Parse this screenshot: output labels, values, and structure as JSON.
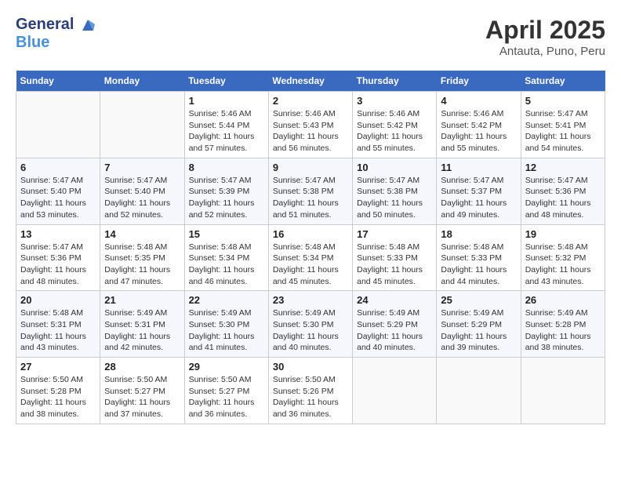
{
  "header": {
    "logo_line1": "General",
    "logo_line2": "Blue",
    "month": "April 2025",
    "location": "Antauta, Puno, Peru"
  },
  "weekdays": [
    "Sunday",
    "Monday",
    "Tuesday",
    "Wednesday",
    "Thursday",
    "Friday",
    "Saturday"
  ],
  "weeks": [
    [
      {
        "day": null
      },
      {
        "day": null
      },
      {
        "day": 1,
        "sunrise": "5:46 AM",
        "sunset": "5:44 PM",
        "daylight": "11 hours and 57 minutes."
      },
      {
        "day": 2,
        "sunrise": "5:46 AM",
        "sunset": "5:43 PM",
        "daylight": "11 hours and 56 minutes."
      },
      {
        "day": 3,
        "sunrise": "5:46 AM",
        "sunset": "5:42 PM",
        "daylight": "11 hours and 55 minutes."
      },
      {
        "day": 4,
        "sunrise": "5:46 AM",
        "sunset": "5:42 PM",
        "daylight": "11 hours and 55 minutes."
      },
      {
        "day": 5,
        "sunrise": "5:47 AM",
        "sunset": "5:41 PM",
        "daylight": "11 hours and 54 minutes."
      }
    ],
    [
      {
        "day": 6,
        "sunrise": "5:47 AM",
        "sunset": "5:40 PM",
        "daylight": "11 hours and 53 minutes."
      },
      {
        "day": 7,
        "sunrise": "5:47 AM",
        "sunset": "5:40 PM",
        "daylight": "11 hours and 52 minutes."
      },
      {
        "day": 8,
        "sunrise": "5:47 AM",
        "sunset": "5:39 PM",
        "daylight": "11 hours and 52 minutes."
      },
      {
        "day": 9,
        "sunrise": "5:47 AM",
        "sunset": "5:38 PM",
        "daylight": "11 hours and 51 minutes."
      },
      {
        "day": 10,
        "sunrise": "5:47 AM",
        "sunset": "5:38 PM",
        "daylight": "11 hours and 50 minutes."
      },
      {
        "day": 11,
        "sunrise": "5:47 AM",
        "sunset": "5:37 PM",
        "daylight": "11 hours and 49 minutes."
      },
      {
        "day": 12,
        "sunrise": "5:47 AM",
        "sunset": "5:36 PM",
        "daylight": "11 hours and 48 minutes."
      }
    ],
    [
      {
        "day": 13,
        "sunrise": "5:47 AM",
        "sunset": "5:36 PM",
        "daylight": "11 hours and 48 minutes."
      },
      {
        "day": 14,
        "sunrise": "5:48 AM",
        "sunset": "5:35 PM",
        "daylight": "11 hours and 47 minutes."
      },
      {
        "day": 15,
        "sunrise": "5:48 AM",
        "sunset": "5:34 PM",
        "daylight": "11 hours and 46 minutes."
      },
      {
        "day": 16,
        "sunrise": "5:48 AM",
        "sunset": "5:34 PM",
        "daylight": "11 hours and 45 minutes."
      },
      {
        "day": 17,
        "sunrise": "5:48 AM",
        "sunset": "5:33 PM",
        "daylight": "11 hours and 45 minutes."
      },
      {
        "day": 18,
        "sunrise": "5:48 AM",
        "sunset": "5:33 PM",
        "daylight": "11 hours and 44 minutes."
      },
      {
        "day": 19,
        "sunrise": "5:48 AM",
        "sunset": "5:32 PM",
        "daylight": "11 hours and 43 minutes."
      }
    ],
    [
      {
        "day": 20,
        "sunrise": "5:48 AM",
        "sunset": "5:31 PM",
        "daylight": "11 hours and 43 minutes."
      },
      {
        "day": 21,
        "sunrise": "5:49 AM",
        "sunset": "5:31 PM",
        "daylight": "11 hours and 42 minutes."
      },
      {
        "day": 22,
        "sunrise": "5:49 AM",
        "sunset": "5:30 PM",
        "daylight": "11 hours and 41 minutes."
      },
      {
        "day": 23,
        "sunrise": "5:49 AM",
        "sunset": "5:30 PM",
        "daylight": "11 hours and 40 minutes."
      },
      {
        "day": 24,
        "sunrise": "5:49 AM",
        "sunset": "5:29 PM",
        "daylight": "11 hours and 40 minutes."
      },
      {
        "day": 25,
        "sunrise": "5:49 AM",
        "sunset": "5:29 PM",
        "daylight": "11 hours and 39 minutes."
      },
      {
        "day": 26,
        "sunrise": "5:49 AM",
        "sunset": "5:28 PM",
        "daylight": "11 hours and 38 minutes."
      }
    ],
    [
      {
        "day": 27,
        "sunrise": "5:50 AM",
        "sunset": "5:28 PM",
        "daylight": "11 hours and 38 minutes."
      },
      {
        "day": 28,
        "sunrise": "5:50 AM",
        "sunset": "5:27 PM",
        "daylight": "11 hours and 37 minutes."
      },
      {
        "day": 29,
        "sunrise": "5:50 AM",
        "sunset": "5:27 PM",
        "daylight": "11 hours and 36 minutes."
      },
      {
        "day": 30,
        "sunrise": "5:50 AM",
        "sunset": "5:26 PM",
        "daylight": "11 hours and 36 minutes."
      },
      {
        "day": null
      },
      {
        "day": null
      },
      {
        "day": null
      }
    ]
  ],
  "labels": {
    "sunrise": "Sunrise:",
    "sunset": "Sunset:",
    "daylight": "Daylight:"
  }
}
